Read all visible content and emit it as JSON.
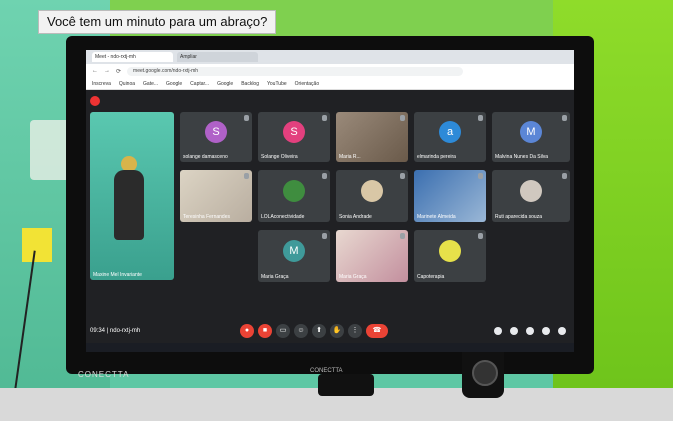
{
  "sign": {
    "text": "Você tem um minuto para um abraço?"
  },
  "monitor": {
    "brand": "CONECTTA",
    "stand_label": "CONECTTA"
  },
  "browser": {
    "tabs": [
      {
        "label": "Meet - ndo-rxtj-mh"
      },
      {
        "label": "Ampliar"
      }
    ],
    "url": "meet.google.com/ndo-rxtj-mh",
    "bookmarks": [
      "Inscreva",
      "Quinoa",
      "Gate...",
      "Google",
      "Captar...",
      "Google",
      "Backlog",
      "YouTube",
      "Orientação"
    ]
  },
  "meeting": {
    "id_text": "09:34 | ndo-rxtj-mh",
    "main_caption": "Maxine Mel Invariante",
    "participants": [
      {
        "name": "solange damasceno",
        "initial": "S",
        "color": "#b061c8"
      },
      {
        "name": "Solange Oliveira",
        "initial": "S",
        "color": "#e3407e"
      },
      {
        "name": "Maria R...",
        "initial": "",
        "color": "#8a7a6a"
      },
      {
        "name": "elmarinda pereira",
        "initial": "a",
        "color": "#2d8ad8"
      },
      {
        "name": "Malvina Nunes Da Silva",
        "initial": "M",
        "color": "#5b86d6"
      },
      {
        "name": "Teresinha Fernandes",
        "initial": "",
        "color": "#9a9a9a"
      },
      {
        "name": "LOLAconectividade",
        "initial": "",
        "color": "#3f8d3f"
      },
      {
        "name": "Sonia Andrade",
        "initial": "",
        "color": "#d9c7a6"
      },
      {
        "name": "Marinete Almeida",
        "initial": "",
        "color": "#3b6fb0"
      },
      {
        "name": "Ruti aparecida souza",
        "initial": "",
        "color": "#d0c8bf"
      },
      {
        "name": "Maria Graça",
        "initial": "M",
        "color": "#3f9a9a"
      },
      {
        "name": "Maria Graça",
        "initial": "",
        "color": "#c38f9e"
      },
      {
        "name": "Capoterapia",
        "initial": "",
        "color": "#e6e14a"
      }
    ]
  }
}
